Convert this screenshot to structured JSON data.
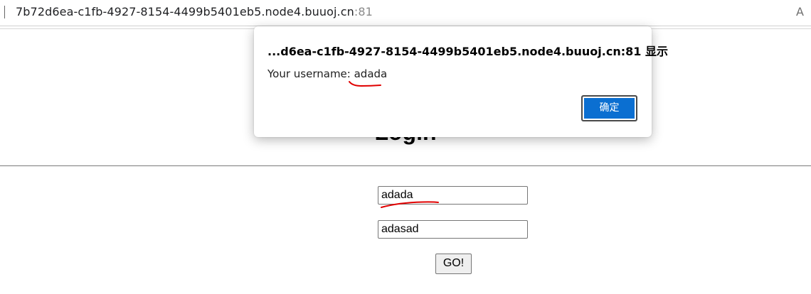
{
  "browser": {
    "url_host": "7b72d6ea-c1fb-4927-8154-4499b5401eb5.node4.buuoj.cn",
    "url_port": ":81",
    "addressbar_right_glyph": "A"
  },
  "dialog": {
    "title": "...d6ea-c1fb-4927-8154-4499b5401eb5.node4.buuoj.cn:81 显示",
    "message": "Your username: adada",
    "ok_label": "确定"
  },
  "page": {
    "heading": "Login",
    "username_value": "adada",
    "password_value": "adasad",
    "submit_label": "GO!"
  },
  "colors": {
    "dialog_button": "#0b6fd1",
    "annotation": "#e00000"
  }
}
